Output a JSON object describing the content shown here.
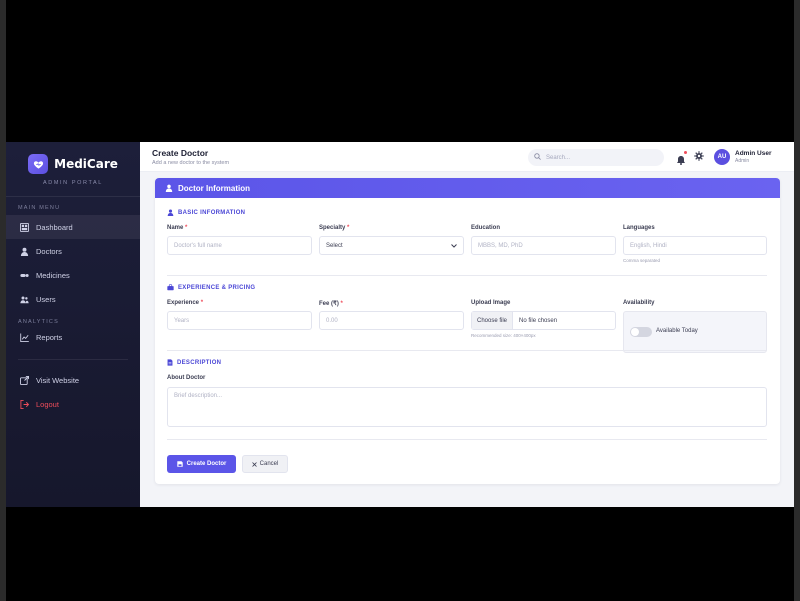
{
  "brand": {
    "name": "MediCare",
    "subtitle": "ADMIN PORTAL"
  },
  "sidebar": {
    "main_menu_label": "MAIN MENU",
    "items": [
      {
        "label": "Dashboard",
        "icon": "dashboard-icon",
        "active": true
      },
      {
        "label": "Doctors",
        "icon": "user-md-icon"
      },
      {
        "label": "Medicines",
        "icon": "pills-icon"
      },
      {
        "label": "Users",
        "icon": "users-icon"
      }
    ],
    "analytics_label": "ANALYTICS",
    "reports_label": "Reports",
    "visit_label": "Visit Website",
    "logout_label": "Logout"
  },
  "topbar": {
    "title": "Create Doctor",
    "subtitle": "Add a new doctor to the system",
    "search_placeholder": "Search...",
    "avatar_initials": "AU",
    "user_name": "Admin User",
    "user_role": "Admin"
  },
  "form": {
    "card_title": "Doctor Information",
    "basic_section": "BASIC INFORMATION",
    "name_label": "Name",
    "name_placeholder": "Doctor's full name",
    "specialty_label": "Specialty",
    "specialty_value": "Select",
    "education_label": "Education",
    "education_placeholder": "MBBS, MD, PhD",
    "languages_label": "Languages",
    "languages_placeholder": "English, Hindi",
    "languages_hint": "Comma separated",
    "experience_section": "EXPERIENCE & PRICING",
    "experience_label": "Experience",
    "experience_placeholder": "Years",
    "fee_label": "Fee (₹)",
    "fee_placeholder": "0.00",
    "upload_label": "Upload Image",
    "choose_file": "Choose file",
    "no_file": "No file chosen",
    "upload_hint": "Recommended size: 400×400px",
    "availability_label": "Availability",
    "available_today": "Available Today",
    "description_section": "DESCRIPTION",
    "about_label": "About Doctor",
    "about_placeholder": "Brief description...",
    "create_button": "Create Doctor",
    "cancel_button": "Cancel",
    "required_mark": "*"
  },
  "colors": {
    "accent": "#5b55e8",
    "sidebar_bg": "#1d1f3a",
    "danger": "#ef4d5b"
  }
}
